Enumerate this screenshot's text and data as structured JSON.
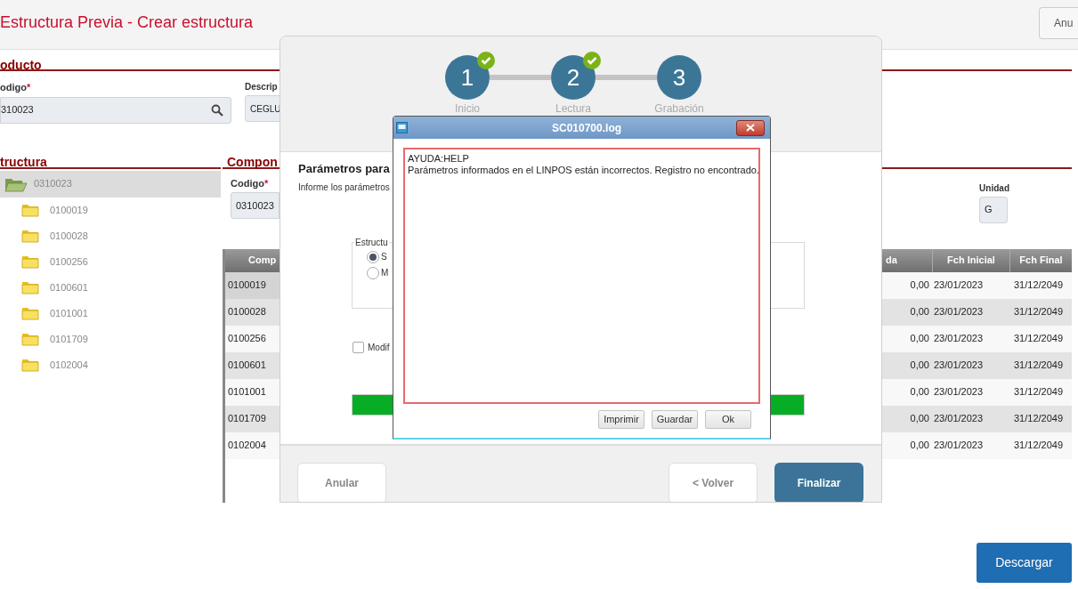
{
  "page": {
    "title": "Estructura Previa - Crear estructura",
    "header_button": "Anu",
    "download_button": "Descargar"
  },
  "product": {
    "heading": "oducto",
    "code_label": "odigo",
    "code_required_mark": "*",
    "code_value": "310023",
    "description_label": "Descrip",
    "description_value": "CEGLU"
  },
  "structure": {
    "heading": "tructura",
    "tree": {
      "label": "0310023",
      "selected": true,
      "expanded": true,
      "children": [
        {
          "label": "0100019",
          "selected": false
        },
        {
          "label": "0100028",
          "selected": false
        },
        {
          "label": "0100256",
          "selected": false
        },
        {
          "label": "0100601",
          "selected": false
        },
        {
          "label": "0101001",
          "selected": false
        },
        {
          "label": "0101709",
          "selected": false
        },
        {
          "label": "0102004",
          "selected": false
        }
      ]
    }
  },
  "components": {
    "heading": "Compon",
    "code_label": "Codigo",
    "code_required_mark": "*",
    "code_value": "0310023",
    "unit_label": "Unidad",
    "unit_value": "G",
    "table": {
      "columns": [
        "Comp",
        "da",
        "Fch Inicial",
        "Fch Final"
      ],
      "rows": [
        {
          "code": "0100019",
          "quantity": "0,00",
          "start": "23/01/2023",
          "end": "31/12/2049",
          "selected": true
        },
        {
          "code": "0100028",
          "quantity": "0,00",
          "start": "23/01/2023",
          "end": "31/12/2049",
          "selected": false
        },
        {
          "code": "0100256",
          "quantity": "0,00",
          "start": "23/01/2023",
          "end": "31/12/2049",
          "selected": false
        },
        {
          "code": "0100601",
          "quantity": "0,00",
          "start": "23/01/2023",
          "end": "31/12/2049",
          "selected": false
        },
        {
          "code": "0101001",
          "quantity": "0,00",
          "start": "23/01/2023",
          "end": "31/12/2049",
          "selected": false
        },
        {
          "code": "0101709",
          "quantity": "0,00",
          "start": "23/01/2023",
          "end": "31/12/2049",
          "selected": false
        },
        {
          "code": "0102004",
          "quantity": "0,00",
          "start": "23/01/2023",
          "end": "31/12/2049",
          "selected": false
        }
      ]
    }
  },
  "wizard": {
    "steps": [
      {
        "number": "1",
        "label": "Inicio",
        "done": true
      },
      {
        "number": "2",
        "label": "Lectura",
        "done": true
      },
      {
        "number": "3",
        "label": "Grabación",
        "done": false
      }
    ],
    "heading": "Parámetros para",
    "subtitle": "Informe los parámetros",
    "group_label": "Estructu",
    "options": [
      {
        "label": "S",
        "selected": true
      },
      {
        "label": "M",
        "selected": false
      }
    ],
    "checkbox": {
      "label": "Modif",
      "checked": false
    },
    "progress": {
      "level": 1
    },
    "buttons": {
      "cancel": "Anular",
      "back": "< Volver",
      "finish": "Finalizar"
    }
  },
  "log_dialog": {
    "title": "SC010700.log",
    "lines": [
      "AYUDA:HELP",
      "Parámetros informados en el LINPOS están incorrectos. Registro no encontrado."
    ],
    "buttons": [
      "Imprimir",
      "Guardar",
      "Ok"
    ]
  }
}
